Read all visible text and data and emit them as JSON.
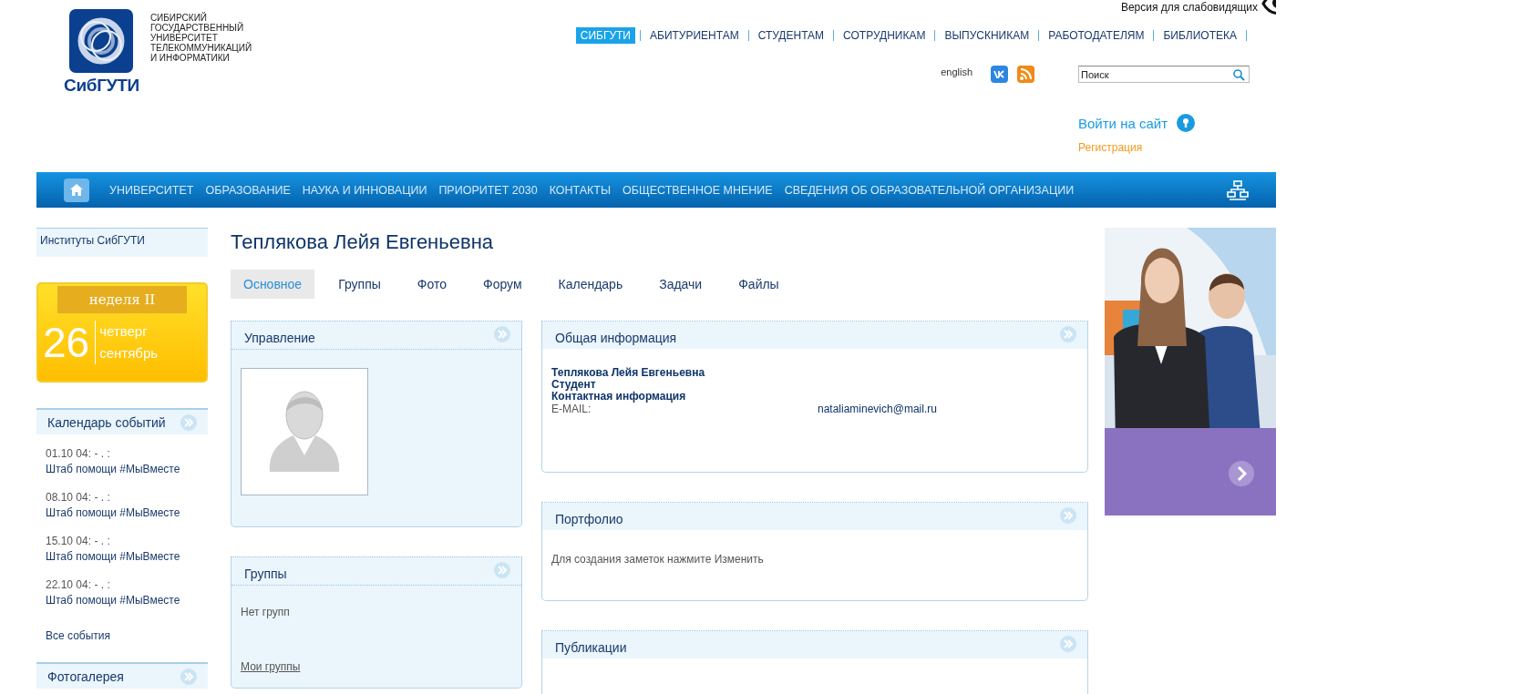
{
  "accessibility_link": "Версия для слабовидящих",
  "logo": {
    "wordmark": "СибГУТИ",
    "full_name_lines": [
      "СИБИРСКИЙ",
      "ГОСУДАРСТВЕННЫЙ",
      "УНИВЕРСИТЕТ",
      "ТЕЛЕКОММУНИКАЦИЙ",
      "И ИНФОРМАТИКИ"
    ]
  },
  "top_menu": [
    {
      "label": "СИБГУТИ",
      "selected": true
    },
    {
      "label": "АБИТУРИЕНТАМ",
      "selected": false
    },
    {
      "label": "СТУДЕНТАМ",
      "selected": false
    },
    {
      "label": "СОТРУДНИКАМ",
      "selected": false
    },
    {
      "label": "ВЫПУСКНИКАМ",
      "selected": false
    },
    {
      "label": "РАБОТОДАТЕЛЯМ",
      "selected": false
    },
    {
      "label": "БИБЛИОТЕКА",
      "selected": false
    }
  ],
  "language_link": "english",
  "search": {
    "placeholder": "Поиск"
  },
  "login": {
    "link": "Войти на сайт",
    "register": "Регистрация"
  },
  "main_nav": [
    "УНИВЕРСИТЕТ",
    "ОБРАЗОВАНИЕ",
    "НАУКА И ИННОВАЦИИ",
    "ПРИОРИТЕТ 2030",
    "КОНТАКТЫ",
    "ОБЩЕСТВЕННОЕ МНЕНИЕ",
    "СВЕДЕНИЯ ОБ ОБРАЗОВАТЕЛЬНОЙ ОРГАНИЗАЦИИ"
  ],
  "sidebar": {
    "institutes_link": "Институты СибГУТИ",
    "date_card": {
      "week": "неделя II",
      "day": "26",
      "weekday": "четверг",
      "month": "сентябрь"
    },
    "events_title": "Календарь событий",
    "events": [
      {
        "date": "01.10 04: - . :",
        "title": "Штаб помощи #МыВместе"
      },
      {
        "date": "08.10 04: - . :",
        "title": "Штаб помощи #МыВместе"
      },
      {
        "date": "15.10 04: - . :",
        "title": "Штаб помощи #МыВместе"
      },
      {
        "date": "22.10 04: - . :",
        "title": "Штаб помощи #МыВместе"
      }
    ],
    "all_events": "Все события",
    "gallery_title": "Фотогалерея"
  },
  "profile": {
    "name": "Теплякова Лейя Евгеньевна",
    "tabs": [
      {
        "label": "Основное",
        "selected": true
      },
      {
        "label": "Группы",
        "selected": false
      },
      {
        "label": "Фото",
        "selected": false
      },
      {
        "label": "Форум",
        "selected": false
      },
      {
        "label": "Календарь",
        "selected": false
      },
      {
        "label": "Задачи",
        "selected": false
      },
      {
        "label": "Файлы",
        "selected": false
      }
    ],
    "left_panels": [
      {
        "title": "Управление"
      },
      {
        "kind": "groups",
        "title": "Группы",
        "text": "Нет групп",
        "link": "Мои группы"
      }
    ],
    "right_panels": [
      {
        "kind": "info",
        "title": "Общая информация",
        "name": "Теплякова Лейя Евгеньевна",
        "role": "Студент",
        "contact_heading": "Контактная информация",
        "fields": [
          {
            "label": "E-MAIL:",
            "value": "nataliaminevich@mail.ru"
          }
        ]
      },
      {
        "kind": "note",
        "title": "Портфолио",
        "text": "Для создания заметок нажмите Изменить"
      },
      {
        "kind": "empty",
        "title": "Публикации"
      }
    ]
  }
}
